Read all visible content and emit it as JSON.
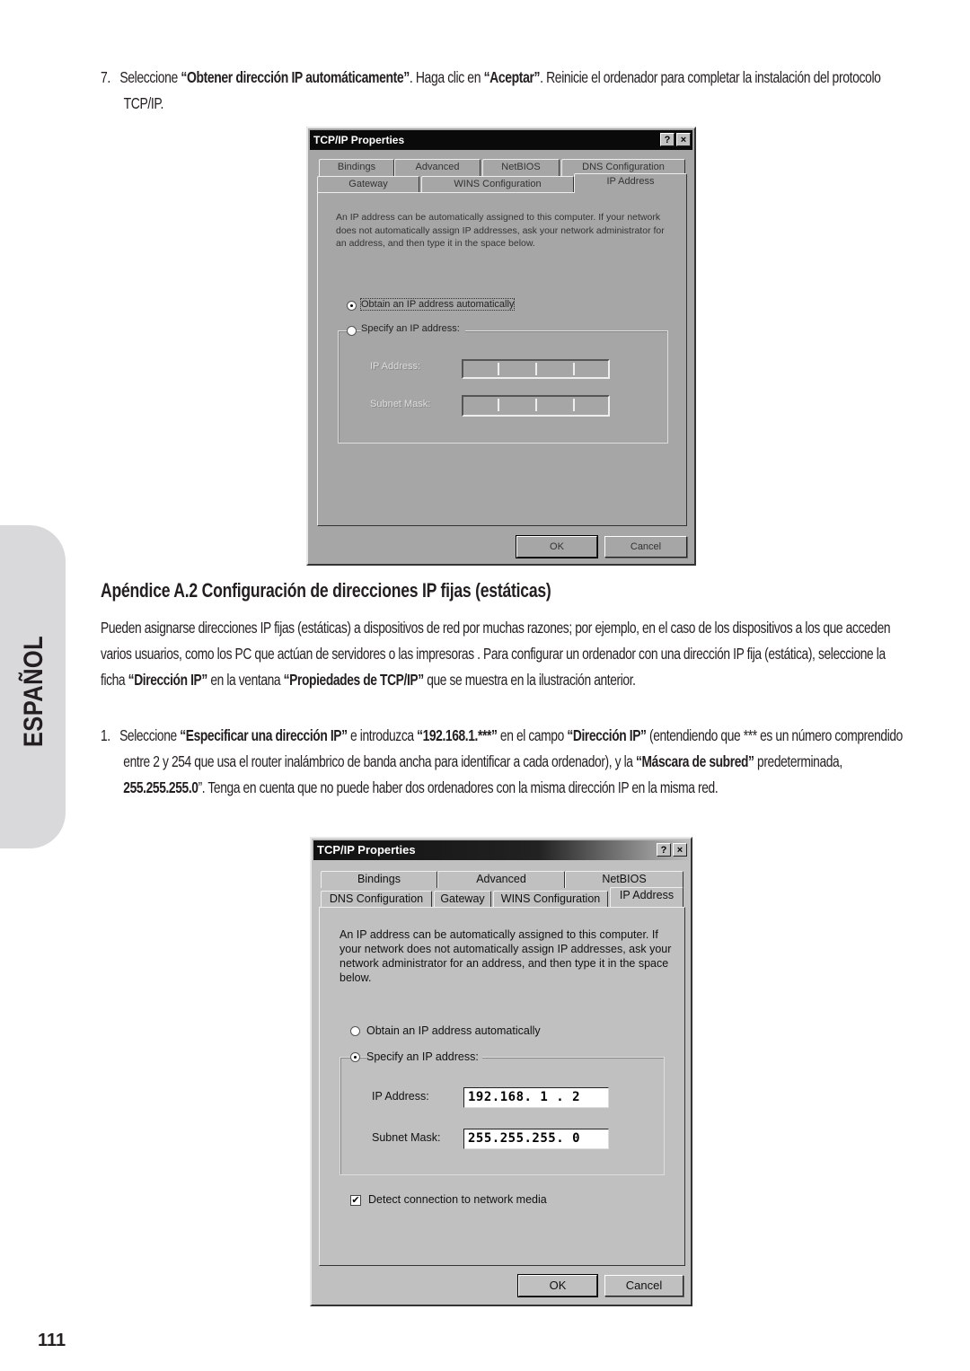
{
  "side_tab": {
    "label": "ESPAÑOL"
  },
  "page_number": "111",
  "step7": {
    "number": "7.",
    "t1": "Seleccione ",
    "b1": "“Obtener dirección IP automáticamente”",
    "t2": ". Haga clic en ",
    "b2": "“Aceptar”",
    "t3": ". Reinicie el ordenador para completar la instalación del protocolo TCP/IP."
  },
  "section": {
    "heading": "Apéndice A.2 Configuración de direcciones IP fijas (estáticas)",
    "paragraph": {
      "t1": "Pueden asignarse direcciones IP fijas (estáticas) a dispositivos de red por muchas razones; por ejemplo, en el caso de los dispositivos a los que acceden varios usuarios, como los PC que actúan de servidores o las impresoras .  Para configurar un ordenador con una dirección IP fija (estática), seleccione la ficha ",
      "b1": "“Dirección IP”",
      "t2": " en la ventana ",
      "b2": "“Propiedades de TCP/IP”",
      "t3": " que se muestra en la ilustración anterior."
    }
  },
  "step1": {
    "number": "1.",
    "t1": "Seleccione ",
    "b1": "“Especificar una dirección IP”",
    "t2": " e introduzca ",
    "b2": "“192.168.1.***”",
    "t3": " en el campo ",
    "b3": "“Dirección IP”",
    "t4": " (entendiendo que *** es un número comprendido entre 2 y 254 que usa el router inalámbrico de banda ancha para identificar a cada ordenador), y la ",
    "b4": "“Máscara de subred”",
    "t5": " predeterminada, ",
    "b5": "255.255.255.0",
    "t6": "”. Tenga en cuenta que no puede haber dos ordenadores con la misma dirección IP en la misma red."
  },
  "dialog1": {
    "title": "TCP/IP Properties",
    "help_btn": "?",
    "close_btn": "×",
    "tabs_row1": [
      "Bindings",
      "Advanced",
      "NetBIOS",
      "DNS Configuration"
    ],
    "tabs_row2": [
      "Gateway",
      "WINS Configuration",
      "IP Address"
    ],
    "active_tab": "IP Address",
    "description": "An IP address can be automatically assigned to this computer.  If your network does not automatically assign IP addresses, ask your network administrator for an address, and then type it in the space below.",
    "radio_auto": "Obtain an IP address automatically",
    "radio_auto_selected": true,
    "radio_specify": "Specify an IP address:",
    "ip_label": "IP Address:",
    "ip_value": "",
    "mask_label": "Subnet Mask:",
    "mask_value": "",
    "ok": "OK",
    "cancel": "Cancel"
  },
  "dialog2": {
    "title": "TCP/IP Properties",
    "help_btn": "?",
    "close_btn": "×",
    "tabs_row1": [
      "Bindings",
      "Advanced",
      "NetBIOS"
    ],
    "tabs_row2": [
      "DNS Configuration",
      "Gateway",
      "WINS Configuration",
      "IP Address"
    ],
    "active_tab": "IP Address",
    "description": "An IP address can be automatically assigned to this computer. If your network does not automatically assign IP addresses, ask your network administrator for an address, and then type it in the space below.",
    "radio_auto": "Obtain an IP address automatically",
    "radio_specify": "Specify an IP address:",
    "radio_specify_selected": true,
    "ip_label": "IP Address:",
    "ip_value": "192.168. 1 . 2",
    "mask_label": "Subnet Mask:",
    "mask_value": "255.255.255. 0",
    "detect_checkbox": "Detect connection to network media",
    "detect_checked": true,
    "ok": "OK",
    "cancel": "Cancel"
  }
}
